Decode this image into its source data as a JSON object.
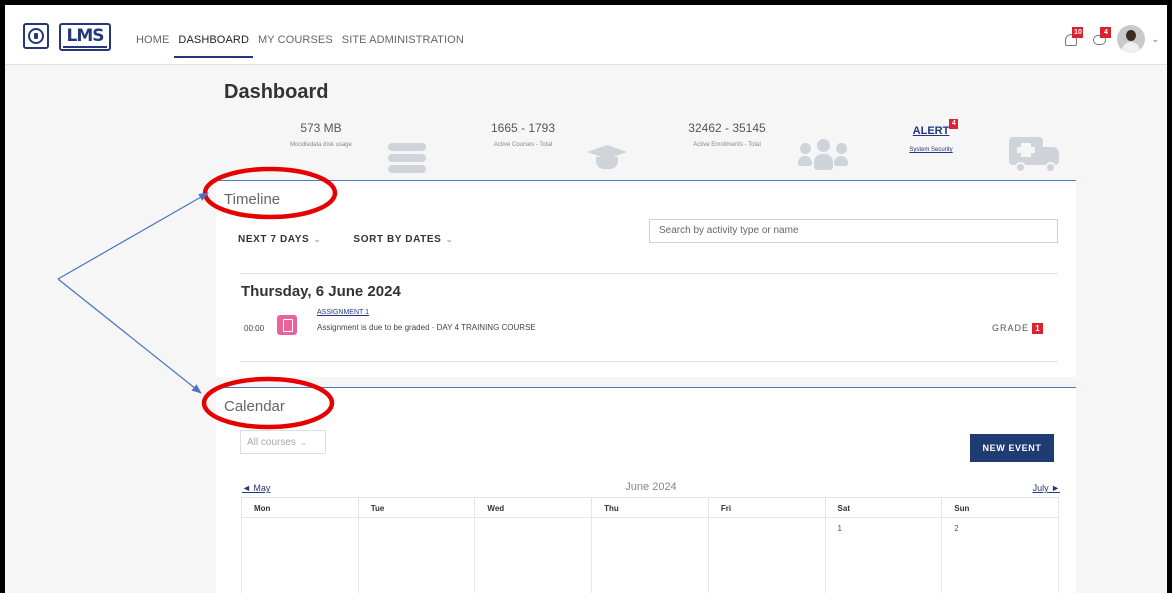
{
  "nav": {
    "items": [
      "HOME",
      "DASHBOARD",
      "MY COURSES",
      "SITE ADMINISTRATION"
    ],
    "notifications_count": "10",
    "messages_count": "4"
  },
  "logo": {
    "text": "LMS"
  },
  "page": {
    "title": "Dashboard"
  },
  "stats": [
    {
      "value": "573 MB",
      "label": "Moodledata disk usage",
      "icon": "database-icon"
    },
    {
      "value": "1665 - 1793",
      "label": "Active Courses - Total",
      "icon": "graduation-cap-icon"
    },
    {
      "value": "32462 - 35145",
      "label": "Active Enrollments - Total",
      "icon": "users-icon"
    }
  ],
  "alert": {
    "label": "ALERT",
    "count": "4",
    "sublabel": "System Security",
    "icon": "ambulance-icon"
  },
  "timeline": {
    "title": "Timeline",
    "filter_days": "NEXT 7 DAYS",
    "filter_sort": "SORT BY DATES",
    "search_placeholder": "Search by activity type or name",
    "date_heading": "Thursday, 6 June 2024",
    "event": {
      "time": "00:00",
      "name": "ASSIGNMENT 1",
      "description": "Assignment is due to be graded · DAY 4 TRAINING COURSE",
      "action": "GRADE",
      "action_count": "1"
    }
  },
  "calendar": {
    "title": "Calendar",
    "course_filter": "All courses",
    "new_event_label": "NEW EVENT",
    "prev_month": "May",
    "current_month": "June 2024",
    "next_month": "July",
    "weekdays": [
      "Mon",
      "Tue",
      "Wed",
      "Thu",
      "Fri",
      "Sat",
      "Sun"
    ],
    "first_week": [
      "",
      "",
      "",
      "",
      "",
      "1",
      "2"
    ]
  },
  "colors": {
    "brand": "#23377a",
    "accent_line": "#4a78c2",
    "badge": "#d9232e",
    "annotation": "#e60000",
    "arrow": "#4a72c4"
  }
}
